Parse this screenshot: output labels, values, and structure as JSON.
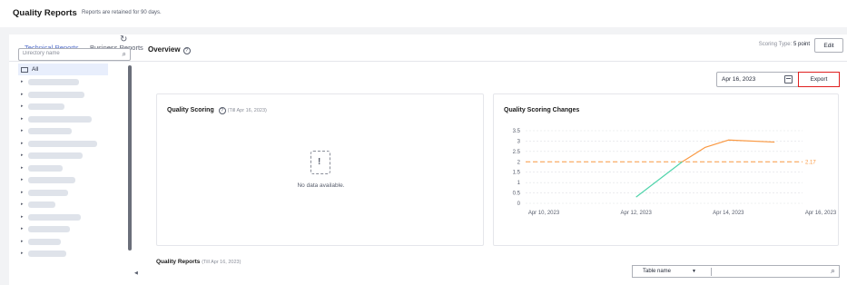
{
  "header": {
    "title": "Quality Reports",
    "subtitle": "Reports are retained for 90 days."
  },
  "tabs": [
    {
      "label": "Technical Reports",
      "active": true
    },
    {
      "label": "Business Reports",
      "active": false
    }
  ],
  "toolbar": {
    "scoring_label": "Scoring Type:",
    "scoring_value": "5 point",
    "edit_label": "Edit"
  },
  "sidebar": {
    "search_placeholder": "Directory name",
    "root_label": "All",
    "blurred_item_count": 15
  },
  "overview": {
    "title": "Overview",
    "help_icon": "?",
    "date": "Apr 16, 2023",
    "export_label": "Export"
  },
  "quality_scoring": {
    "title": "Quality Scoring",
    "help_icon": "?",
    "note": "(Till Apr 16, 2023)",
    "empty_text": "No data available."
  },
  "chart_data": {
    "type": "line",
    "title": "Quality Scoring Changes",
    "xlabel": "",
    "ylabel": "",
    "x_ticks": [
      "Apr 10, 2023",
      "Apr 12, 2023",
      "Apr 14, 2023",
      "Apr 16, 2023"
    ],
    "y_ticks": [
      "0",
      "0.5",
      "1",
      "1.5",
      "2",
      "2.5",
      "3",
      "3.5"
    ],
    "ylim": [
      0,
      3.5
    ],
    "grid": true,
    "series": [
      {
        "values": [
          {
            "x": "Apr 12, 2023",
            "y": 0.3
          },
          {
            "x": "Apr 13, 2023",
            "y": 2.0
          }
        ],
        "color": "#50d4ab"
      },
      {
        "values": [
          {
            "x": "Apr 13, 2023",
            "y": 2.0
          },
          {
            "x": "Apr 13, 2023 12:00",
            "y": 2.7
          },
          {
            "x": "Apr 14, 2023",
            "y": 3.05
          },
          {
            "x": "Apr 15, 2023",
            "y": 2.95
          }
        ],
        "color": "#fa9841"
      }
    ],
    "reference_line": {
      "value": 2,
      "label": "2.17",
      "color": "#fa9841"
    }
  },
  "quality_reports": {
    "title": "Quality Reports",
    "note": "(Till Apr 16, 2023)",
    "filter_value": "Table name"
  }
}
